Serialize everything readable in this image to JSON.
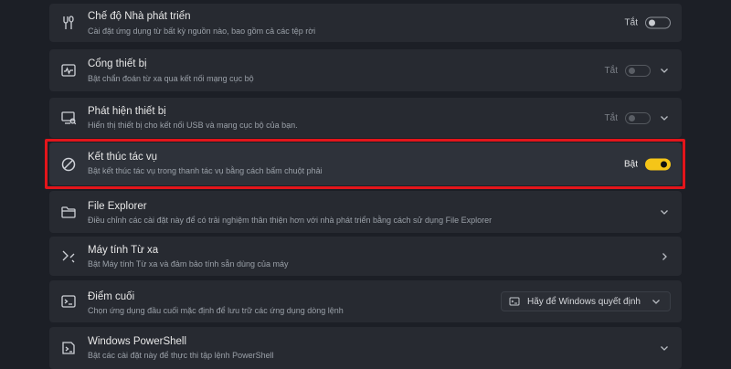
{
  "settings": [
    {
      "title": "Chế độ Nhà phát triển",
      "desc": "Cài đặt ứng dụng từ bất kỳ nguồn nào, bao gồm cả các tệp rời",
      "icon": "developer-tools-icon",
      "state_label": "Tắt",
      "toggle": "off"
    },
    {
      "title": "Cổng thiết bị",
      "desc": "Bật chẩn đoán từ xa qua kết nối mạng cục bộ",
      "icon": "device-portal-icon",
      "state_label": "Tắt",
      "toggle": "disabled",
      "expand": true
    },
    {
      "title": "Phát hiện thiết bị",
      "desc": "Hiển thị thiết bị cho kết nối USB và mạng cục bộ của bạn.",
      "icon": "device-discovery-icon",
      "state_label": "Tắt",
      "toggle": "disabled",
      "expand": true
    },
    {
      "title": "Kết thúc tác vụ",
      "desc": "Bật kết thúc tác vụ trong thanh tác vụ bằng cách bấm chuột phải",
      "icon": "end-task-icon",
      "state_label": "Bật",
      "toggle": "on"
    },
    {
      "title": "File Explorer",
      "desc": "Điều chỉnh các cài đặt này để có trải nghiệm thân thiện hơn với nhà phát triển bằng cách sử dụng File Explorer",
      "icon": "folder-icon",
      "expand": true
    },
    {
      "title": "Máy tính Từ xa",
      "desc": "Bật Máy tính Từ xa và đảm bảo tính sẵn dùng của máy",
      "icon": "remote-desktop-icon",
      "navigate": true
    },
    {
      "title": "Điểm cuối",
      "desc": "Chọn ứng dụng đầu cuối mặc định để lưu trữ các ứng dụng dòng lệnh",
      "icon": "terminal-icon",
      "dropdown": "Hãy để Windows quyết định"
    },
    {
      "title": "Windows PowerShell",
      "desc": "Bật các cài đặt này để thực thi tập lệnh PowerShell",
      "icon": "powershell-icon",
      "expand": true
    }
  ],
  "colors": {
    "background": "#1c1f26",
    "card": "#272a31",
    "toggle_on": "#f5c518",
    "highlight_border": "#e3151b"
  }
}
